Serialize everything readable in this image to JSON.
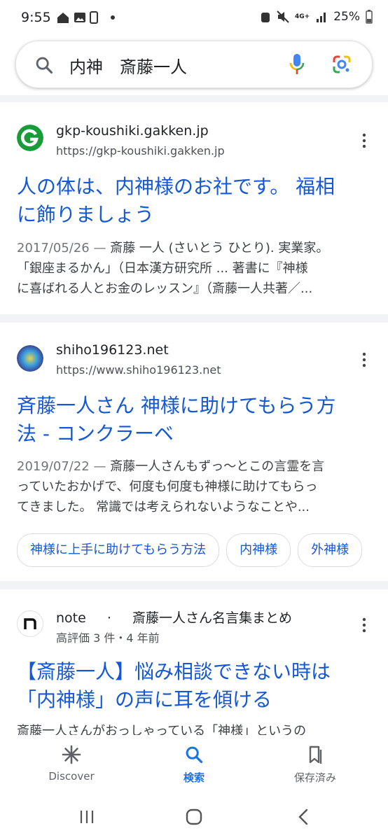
{
  "status_bar": {
    "time": "9:55",
    "network": "4G+",
    "battery": "25%"
  },
  "search": {
    "query": "内神　斎藤一人"
  },
  "results": [
    {
      "site_name": "gkp-koushiki.gakken.jp",
      "url": "https://gkp-koushiki.gakken.jp",
      "title_line1": "人の体は、内神様のお社です。 福相",
      "title_line2": "に飾りましょう",
      "date": "2017/05/26",
      "dash": " — ",
      "snippet_line1": "斎藤 一人 (さいとう ひとり). 実業家。",
      "snippet_line2": "「銀座まるかん」（日本漢方研究所 ... 著書に『神様",
      "snippet_line3": "に喜ばれる人とお金のレッスン』（斎藤一人共著／..."
    },
    {
      "site_name": "shiho196123.net",
      "url": "https://www.shiho196123.net",
      "title_line1": "斉藤一人さん 神様に助けてもらう方",
      "title_line2": "法 - コンクラーベ",
      "date": "2019/07/22",
      "dash": " — ",
      "snippet_line1": "斎藤一人さんもずっ～とこの言霊を言",
      "snippet_line2": "っていたおかげで、何度も何度も神様に助けてもらっ",
      "snippet_line3": "てきました。 常識では考えられないようなことや..."
    },
    {
      "site_name": "note",
      "site_sep": "·",
      "site_extra": "斎藤一人さん名言集まとめ",
      "meta": "高評価 3 件・4 年前",
      "title_line1": "【斎藤一人】悩み相談できない時は",
      "title_line2": "「内神様」の声に耳を傾ける",
      "snippet_line1": "斎藤一人さんがおっしゃっている「神様」というの"
    }
  ],
  "chips": [
    "神様に上手に助けてもらう方法",
    "内神様",
    "外神様"
  ],
  "bottom_nav": {
    "discover": "Discover",
    "search": "検索",
    "saved": "保存済み"
  },
  "colors": {
    "link": "#1558d6",
    "accent": "#1a73e8",
    "separator": "#f1f3f4"
  },
  "icons": [
    "search-icon",
    "mic-icon",
    "google-lens-icon",
    "more-vert-icon",
    "asterisk-icon",
    "bookmark-icon"
  ]
}
